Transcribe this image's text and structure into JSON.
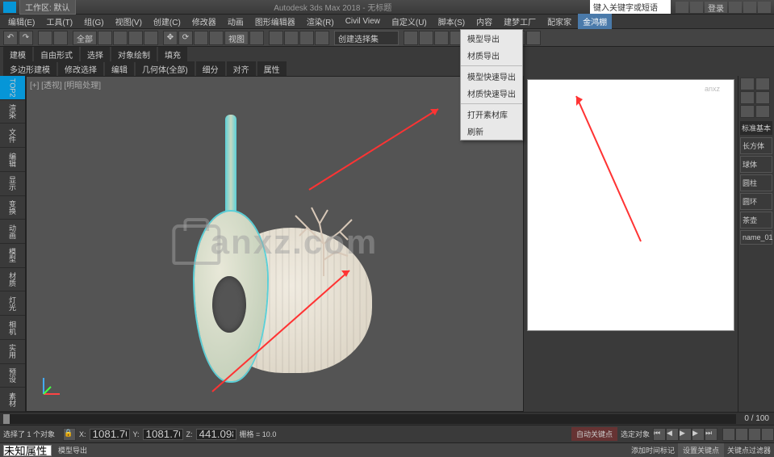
{
  "titlebar": {
    "workspace_label": "工作区: 默认",
    "app_title": "Autodesk 3ds Max 2018 - 无标题",
    "search_placeholder": "键入关键字或短语",
    "login": "登录"
  },
  "menubar": {
    "items": [
      "编辑(E)",
      "工具(T)",
      "组(G)",
      "视图(V)",
      "创建(C)",
      "修改器",
      "动画",
      "图形编辑器",
      "渲染(R)",
      "Civil View",
      "自定义(U)",
      "脚本(S)",
      "内容",
      "建梦工厂",
      "配家家"
    ],
    "highlight": "金鸿棚"
  },
  "toolbar": {
    "dropdown1": "全部",
    "input1": "创建选择集"
  },
  "tabs": {
    "row1": [
      "建模",
      "自由形式",
      "选择",
      "对象绘制",
      "填充"
    ],
    "row2": [
      "多边形建模",
      "修改选择",
      "编辑",
      "几何体(全部)",
      "细分",
      "对齐",
      "属性"
    ]
  },
  "left_sidebar": {
    "items": [
      "TOP2",
      "渲染",
      "文件",
      "编辑",
      "显示",
      "变换",
      "动画",
      "模型",
      "材质",
      "灯光",
      "相机",
      "实用",
      "预设",
      "素材"
    ]
  },
  "viewport": {
    "label": "[+] [透视] [明暗处理]"
  },
  "dropdown_menu": {
    "items": [
      "模型导出",
      "材质导出",
      "",
      "模型快速导出",
      "材质快速导出",
      "",
      "打开素材库",
      "刷新"
    ]
  },
  "right_sidebar": {
    "header": "标准基本",
    "buttons": [
      "长方体",
      "球体",
      "圆柱",
      "圆环",
      "茶壶",
      "name_01"
    ]
  },
  "floating_panel": {
    "logo": "anxz"
  },
  "timeline": {
    "range": "0 / 100"
  },
  "statusbar": {
    "selection": "选择了 1 个对象",
    "x": "X:",
    "y": "Y:",
    "z": "Z:",
    "xv": "1081.702",
    "yv": "1081.702",
    "zv": "441.098",
    "grid": "栅格 = 10.0",
    "autokey": "自动关键点",
    "selfilter": "选定对象"
  },
  "bottombar": {
    "field": "未知属性",
    "hint": "模型导出",
    "keyframe": "设置关键点",
    "filter": "关键点过滤器",
    "addtime": "添加时间标记"
  },
  "watermark": "anxz.com"
}
